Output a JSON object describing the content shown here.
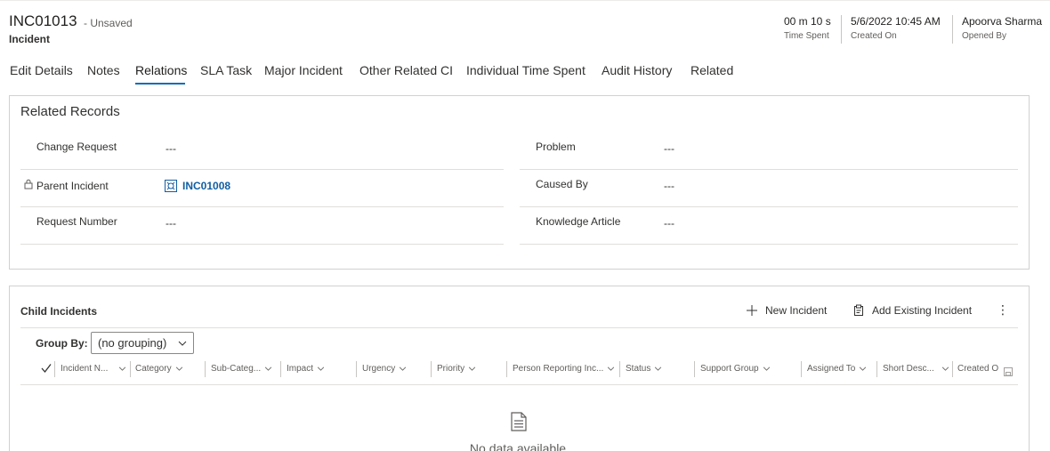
{
  "header": {
    "record_id": "INC01013",
    "save_state": "- Unsaved",
    "entity": "Incident",
    "fields": [
      {
        "value": "00 m 10 s",
        "label": "Time Spent"
      },
      {
        "value": "5/6/2022 10:45 AM",
        "label": "Created On"
      },
      {
        "value": "Apoorva Sharma",
        "label": "Opened By"
      }
    ]
  },
  "tabs": [
    "Edit Details",
    "Notes",
    "Relations",
    "SLA Task",
    "Major Incident",
    "Other Related CI",
    "Individual Time Spent",
    "Audit History",
    "Related"
  ],
  "active_tab": "Relations",
  "related_records": {
    "title": "Related Records",
    "left": [
      {
        "label": "Change Request",
        "value": "---"
      },
      {
        "label": "Parent Incident",
        "value": "INC01008"
      },
      {
        "label": "Request Number",
        "value": "---"
      }
    ],
    "right": [
      {
        "label": "Problem",
        "value": "---"
      },
      {
        "label": "Caused By",
        "value": "---"
      },
      {
        "label": "Knowledge Article",
        "value": "---"
      }
    ]
  },
  "child_incidents": {
    "title": "Child Incidents",
    "new_label": "New Incident",
    "add_existing_label": "Add Existing Incident",
    "more_label": "⋮",
    "group_by_label": "Group By:",
    "group_by_value": "(no grouping)",
    "columns": [
      "Incident N...",
      "Category",
      "Sub-Categ...",
      "Impact",
      "Urgency",
      "Priority",
      "Person Reporting Inc...",
      "Status",
      "Support Group",
      "Assigned To",
      "Short Desc...",
      "Created O"
    ],
    "empty_text": "No data available"
  },
  "colors": {
    "accent": "#0f6cbd",
    "link": "#115ea3"
  },
  "icons": [
    "lock-icon",
    "record-icon",
    "plus-icon",
    "clipboard-icon",
    "more-vertical-icon",
    "chevron-down-icon",
    "checkmark-icon",
    "document-icon",
    "save-icon"
  ]
}
